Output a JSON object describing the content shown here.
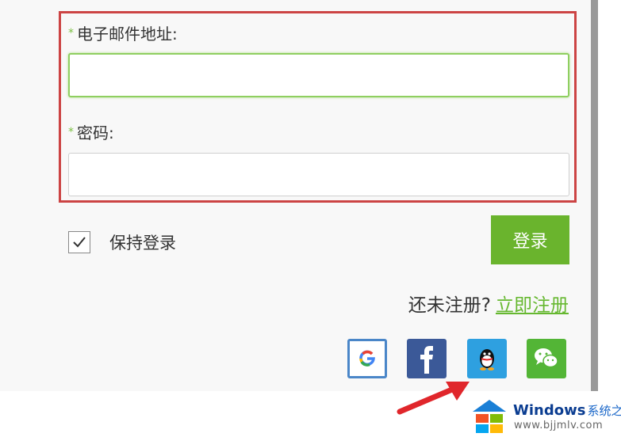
{
  "form": {
    "required_mark": "*",
    "email_label": "电子邮件地址:",
    "email_value": "",
    "password_label": "密码:",
    "password_value": "",
    "keep_login_label": "保持登录",
    "keep_login_checked": true,
    "login_button": "登录",
    "not_registered": "还未注册?",
    "register_link": "立即注册"
  },
  "social": [
    {
      "name": "google-icon",
      "glyph": "G"
    },
    {
      "name": "facebook-icon",
      "glyph": "f"
    },
    {
      "name": "qq-icon",
      "glyph": ""
    },
    {
      "name": "wechat-icon",
      "glyph": ""
    }
  ],
  "watermark": {
    "brand": "Windows",
    "brand_cn": "系统之家",
    "url": "www.bjjmlv.com"
  },
  "colors": {
    "accent": "#6ab42d",
    "highlight": "#cc4444",
    "link": "#66b830"
  }
}
